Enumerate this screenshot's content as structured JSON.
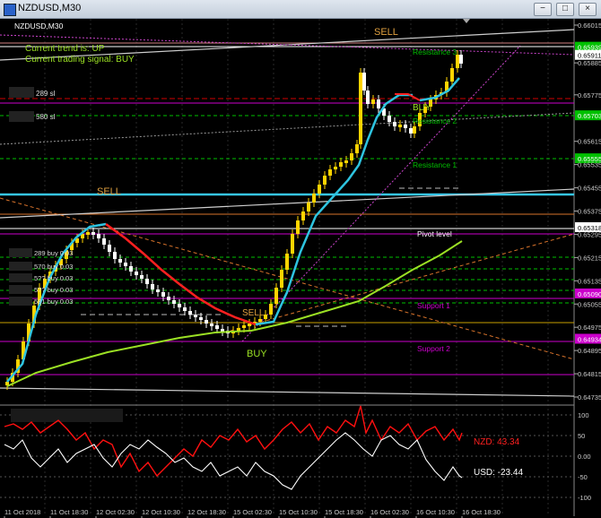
{
  "window": {
    "title": "NZDUSD,M30",
    "buttons": {
      "minimize": "−",
      "maximize": "□",
      "close": "×"
    }
  },
  "chart": {
    "symbol_label": "NZDUSD,M30",
    "trend_line": "Current trend is: UP",
    "signal_line": "Current trading signal: BUY",
    "annotations": {
      "sell_top": "SELL",
      "sell_left": "SELL",
      "buy_mid": "BUY",
      "buy_bottom": "BUY",
      "sell_mid": "SELL"
    },
    "levels": {
      "resistance3": "Resistance 3",
      "resistance2": "Resistance 2",
      "resistance1": "Resistance 1",
      "pivot": "Pivot level",
      "support1": "Support 1",
      "support2": "Support 2"
    },
    "side_labels": [
      {
        "text": "289 sl"
      },
      {
        "text": "580 sl"
      },
      {
        "text": "289 buy 0.03"
      },
      {
        "text": "570 buy 0.03"
      },
      {
        "text": "5?? buy 0.03"
      },
      {
        "text": "5?? buy 0.03"
      },
      {
        "text": "581 buy 0.03"
      }
    ],
    "price_axis": [
      "0.66015",
      "0.65939",
      "0.65911",
      "0.65885",
      "0.65775",
      "0.65703",
      "0.65615",
      "0.65555",
      "0.65535",
      "0.65455",
      "0.65375",
      "0.65318",
      "0.65295",
      "0.65215",
      "0.65135",
      "0.65090",
      "0.65055",
      "0.64975",
      "0.64934",
      "0.64895",
      "0.64815",
      "0.64735"
    ],
    "highlighted_prices": [
      {
        "text": "0.65939",
        "color": "#00c000"
      },
      {
        "text": "0.65911",
        "color": "#ffffff"
      },
      {
        "text": "0.65703",
        "color": "#00c000"
      },
      {
        "text": "0.65555",
        "color": "#00c000"
      },
      {
        "text": "0.65318",
        "color": "#ffffff"
      },
      {
        "text": "0.65090",
        "color": "#cc00cc"
      },
      {
        "text": "0.64934",
        "color": "#cc00cc"
      }
    ],
    "time_axis": [
      "11 Oct 2018",
      "11 Oct 18:30",
      "12 Oct 02:30",
      "12 Oct 10:30",
      "12 Oct 18:30",
      "15 Oct 02:30",
      "15 Oct 10:30",
      "15 Oct 18:30",
      "16 Oct 02:30",
      "16 Oct 10:30",
      "16 Oct 18:30"
    ]
  },
  "indicator": {
    "axis": [
      "100",
      "50",
      "0.00",
      "-50",
      "-100"
    ],
    "nzd_label": "NZD: 43.34",
    "usd_label": "USD: -23.44"
  },
  "colors": {
    "bull_candle": "#ffd400",
    "bear_candle": "#ffffff",
    "ma_fast_up": "#2ec4e0",
    "ma_fast_down": "#ff2020",
    "ma_slow": "#9be024",
    "nzd_line": "#ff1010",
    "usd_line": "#ffffff",
    "resistance": "#00c000",
    "support": "#cc00cc"
  }
}
